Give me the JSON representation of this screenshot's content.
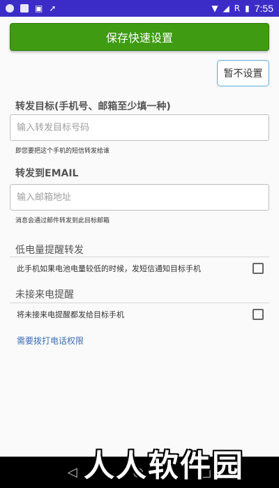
{
  "status_bar": {
    "time": "7:55",
    "icons": [
      "circle-icon",
      "square-icon",
      "download-icon",
      "flame-icon",
      "wifi-icon",
      "signal-icon",
      "r-roaming-icon",
      "battery-icon"
    ],
    "roaming_label": "R"
  },
  "toolbar": {
    "save_label": "保存快速设置",
    "skip_label": "暂不设置"
  },
  "forward_target": {
    "title": "转发目标(手机号、邮箱至少填一种)",
    "placeholder": "输入转发目标号码",
    "value": "",
    "hint": "即您要把这个手机的短信转发给谁"
  },
  "email": {
    "title": "转发到EMAIL",
    "placeholder": "输入邮箱地址",
    "value": "",
    "hint": "消息会通过邮件转发到此目标邮箱"
  },
  "low_battery": {
    "title": "低电量提醒转发",
    "option_label": "此手机如果电池电量较低的时候，发短信通知目标手机",
    "checked": false
  },
  "missed_call": {
    "title": "未接来电提醒",
    "option_label": "将未接来电提醒都发给目标手机",
    "checked": false,
    "permission_link": "需要拨打电话权限"
  },
  "nav_bar": {
    "icons": [
      "back-icon",
      "home-icon",
      "recents-icon"
    ]
  },
  "watermark": "人人软件园",
  "colors": {
    "status_bar": "#3c2cc7",
    "primary_button": "#3e9b12",
    "link": "#3a6db0",
    "skip_border": "#5aaad8"
  }
}
